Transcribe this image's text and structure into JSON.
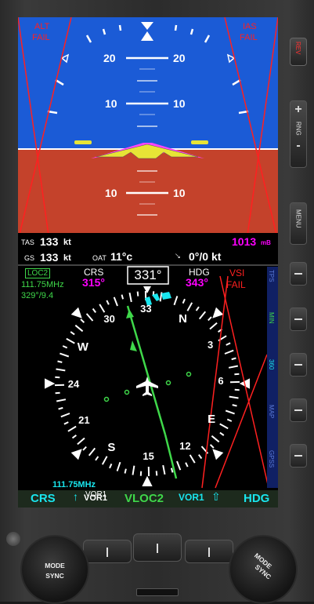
{
  "attitude": {
    "alt_fail": [
      "ALT",
      "FAIL"
    ],
    "ias_fail": [
      "IAS",
      "FAIL"
    ],
    "pitch_labels": [
      "20",
      "20",
      "10",
      "10",
      "10",
      "10"
    ],
    "tas_label": "TAS",
    "tas_value": "133",
    "tas_unit": "kt",
    "gs_label": "GS",
    "gs_value": "133",
    "gs_unit": "kt",
    "oat_label": "OAT",
    "oat_value": "11°c",
    "baro_value": "1013",
    "baro_unit": "mB",
    "wind_value": "0°/0 kt"
  },
  "hsi": {
    "nav_source_badge": "LOC2",
    "nav_freq": "111.75MHz",
    "bearing_dist": "329°/9.4",
    "crs_label": "CRS",
    "crs_value": "315°",
    "heading_box": "331°",
    "hdg_label": "HDG",
    "hdg_value": "343°",
    "vsi_fail": [
      "VSI",
      "FAIL"
    ],
    "compass_labels": [
      "N",
      "3",
      "6",
      "E",
      "12",
      "15",
      "S",
      "21",
      "24",
      "W",
      "30",
      "33"
    ],
    "bottom_freq": "111.75MHz",
    "bottom_vor": "VOR1",
    "colors": {
      "cyan": "#19e6ee",
      "magenta": "#ff00ff",
      "green": "#3fd84a",
      "red": "#ff2020"
    }
  },
  "side_tabs": [
    "TPS",
    "MIN",
    "360",
    "MAP",
    "GPSS"
  ],
  "softkeys": {
    "crs": "CRS",
    "vor1_left": "VOR1",
    "vloc2": "VLOC2",
    "vor1_right": "VOR1",
    "hdg": "HDG"
  },
  "bezel": {
    "rev": "REV",
    "rng": "RNG",
    "plus": "+",
    "minus": "-",
    "menu": "MENU",
    "knob_left": [
      "MODE",
      "SYNC"
    ],
    "knob_right": [
      "MODE",
      "SYNC"
    ]
  }
}
